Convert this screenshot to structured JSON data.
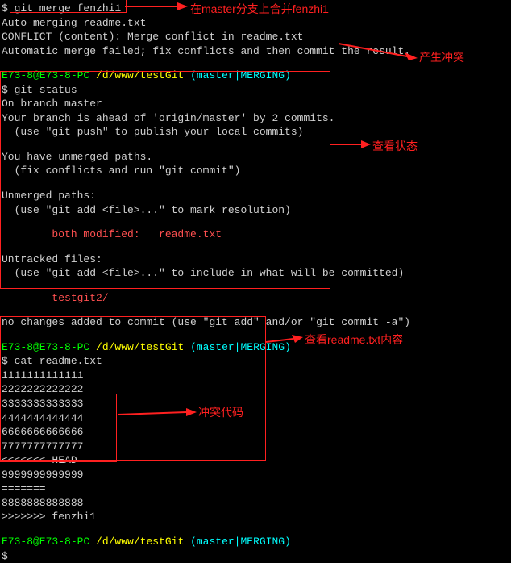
{
  "merge_cmd": "$ git merge fenzhi1",
  "merge_out1": "Auto-merging readme.txt",
  "merge_out2": "CONFLICT (content): Merge conflict in readme.txt",
  "merge_out3": "Automatic merge failed; fix conflicts and then commit the result.",
  "prompt_user": "E73-8@E73-8-PC ",
  "prompt_path": "/d/www/testGit ",
  "prompt_branch": "(master|MERGING)",
  "status_cmd": "$ git status",
  "status1": "On branch master",
  "status2": "Your branch is ahead of 'origin/master' by 2 commits.",
  "status3": "  (use \"git push\" to publish your local commits)",
  "status4": "You have unmerged paths.",
  "status5": "  (fix conflicts and run \"git commit\")",
  "status6": "Unmerged paths:",
  "status7": "  (use \"git add <file>...\" to mark resolution)",
  "status8": "        both modified:   readme.txt",
  "status9": "Untracked files:",
  "status10": "  (use \"git add <file>...\" to include in what will be committed)",
  "status11": "        testgit2/",
  "status12": "no changes added to commit (use \"git add\" and/or \"git commit -a\")",
  "cat_cmd": "$ cat readme.txt",
  "cat1": "1111111111111",
  "cat2": "2222222222222",
  "cat3": "3333333333333",
  "cat4": "4444444444444",
  "cat5": "6666666666666",
  "cat6": "7777777777777",
  "cat7": "<<<<<<< HEAD",
  "cat8": "9999999999999",
  "cat9": "=======",
  "cat10": "8888888888888",
  "cat11": ">>>>>>> fenzhi1",
  "final_prompt": "$",
  "annot1": "在master分支上合并fenzhi1",
  "annot2": "产生冲突",
  "annot3": "查看状态",
  "annot4": "查看readme.txt内容",
  "annot5": "冲突代码"
}
